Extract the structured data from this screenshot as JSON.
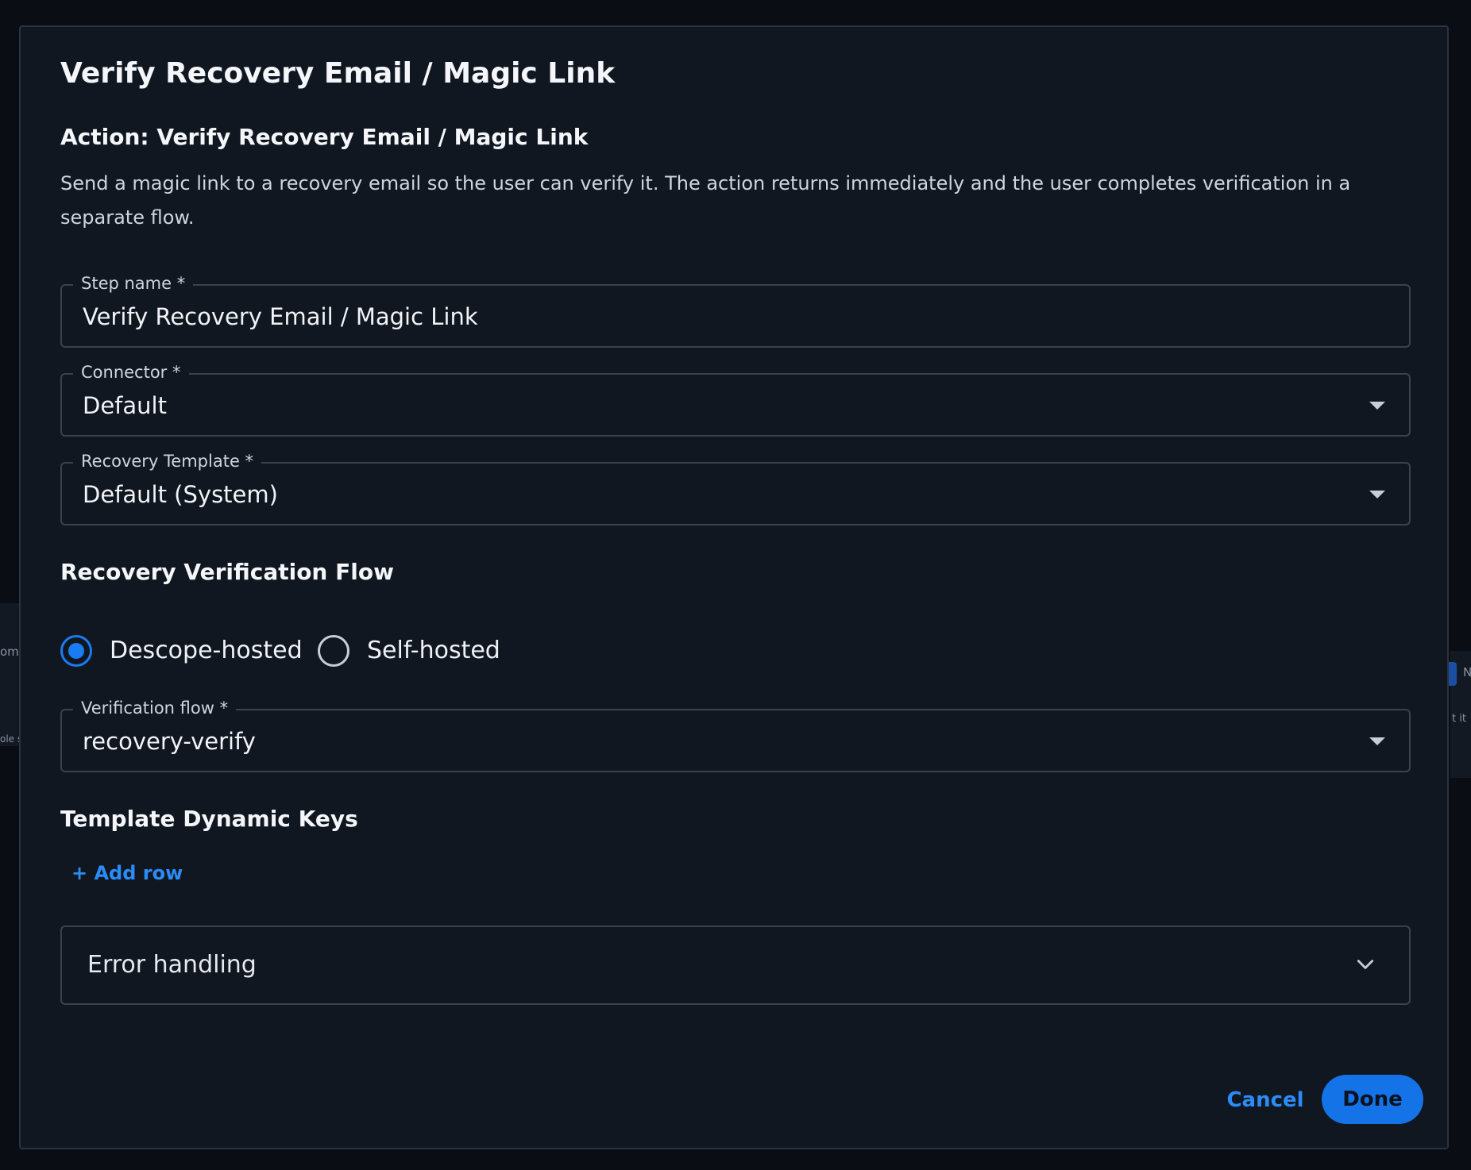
{
  "modal": {
    "title": "Verify Recovery Email / Magic Link",
    "action_title": "Action: Verify Recovery Email / Magic Link",
    "description": "Send a magic link to a recovery email so the user can verify it. The action returns immediately and the user completes verification in a separate flow."
  },
  "fields": {
    "step_name": {
      "label": "Step name *",
      "value": "Verify Recovery Email / Magic Link"
    },
    "connector": {
      "label": "Connector *",
      "value": "Default"
    },
    "recovery_template": {
      "label": "Recovery Template *",
      "value": "Default (System)"
    },
    "verification_flow": {
      "label": "Verification flow *",
      "value": "recovery-verify"
    }
  },
  "recovery_flow": {
    "title": "Recovery Verification Flow",
    "options": [
      {
        "label": "Descope-hosted",
        "checked": true
      },
      {
        "label": "Self-hosted",
        "checked": false
      }
    ]
  },
  "dynamic_keys": {
    "title": "Template Dynamic Keys",
    "add_row": "+ Add row"
  },
  "error_handling": {
    "label": "Error handling"
  },
  "actions": {
    "cancel": "Cancel",
    "done": "Done"
  },
  "background": {
    "left_text_1": "ome",
    "left_text_2": "ole s",
    "right_text_1": "N",
    "right_text_2": "t it"
  },
  "colors": {
    "accent": "#1a7cf2",
    "surface": "#111720",
    "border": "#3a4250"
  }
}
